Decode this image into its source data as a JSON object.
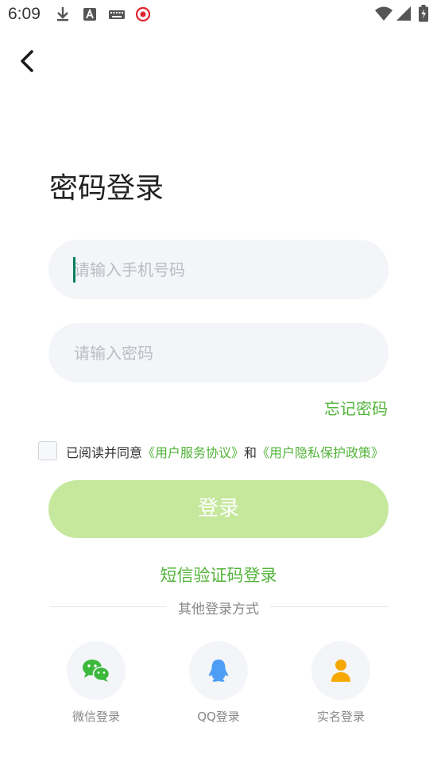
{
  "status_bar": {
    "time": "6:09",
    "left_icons": [
      "download-icon",
      "text-a-icon",
      "keyboard-icon",
      "target-icon"
    ],
    "right_icons": [
      "wifi-icon",
      "signal-icon",
      "battery-icon"
    ]
  },
  "nav": {
    "back_icon": "chevron-left-icon"
  },
  "page": {
    "title": "密码登录"
  },
  "form": {
    "phone": {
      "placeholder": "请输入手机号码",
      "value": ""
    },
    "password": {
      "placeholder": "请输入密码",
      "value": ""
    },
    "forgot_label": "忘记密码"
  },
  "agreement": {
    "checked": false,
    "prefix": "已阅读并同意",
    "user_agreement": "《用户服务协议》",
    "conjunction": "和",
    "privacy_policy": "《用户隐私保护政策》"
  },
  "login_button": {
    "label": "登录"
  },
  "sms_login": {
    "label": "短信验证码登录"
  },
  "other_methods": {
    "divider_label": "其他登录方式",
    "items": [
      {
        "label": "微信登录",
        "icon": "wechat-icon"
      },
      {
        "label": "QQ登录",
        "icon": "qq-icon"
      },
      {
        "label": "实名登录",
        "icon": "person-icon"
      }
    ]
  },
  "colors": {
    "accent": "#52b33a",
    "button_bg": "#c6e89d",
    "field_bg": "#f3f5f8",
    "wechat": "#3cb93c",
    "qq": "#4f9ef5",
    "person": "#f6a800"
  }
}
